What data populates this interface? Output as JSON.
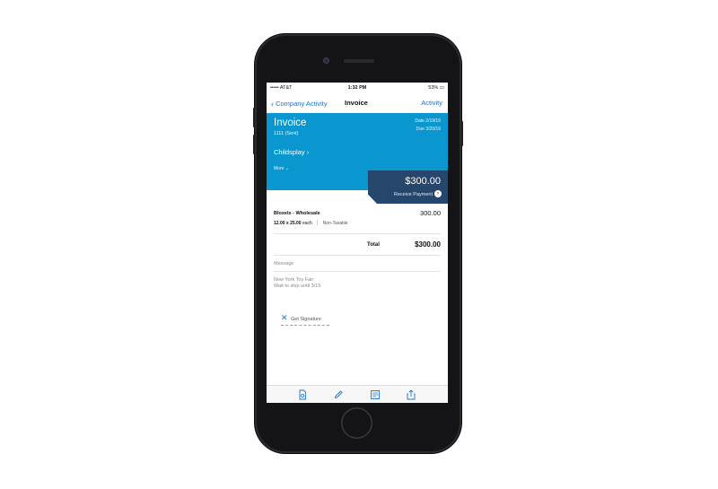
{
  "status_bar": {
    "carrier": "••••• AT&T ",
    "time": "1:32 PM",
    "battery": "53% ▭"
  },
  "nav": {
    "back_label": "Company Activity",
    "title": "Invoice",
    "right_label": "Activity"
  },
  "invoice": {
    "title": "Invoice",
    "number_status": "1111 (Sent)",
    "date": "Date 2/19/16",
    "due": "Due 3/20/16",
    "customer": "Childsplay",
    "more_label": "More"
  },
  "payment": {
    "amount": "$300.00",
    "button_label": "Receive Payment"
  },
  "line_items": [
    {
      "name": "Bloxels - Wholesale",
      "qty_rate": "12.00 x 25.00",
      "unit": "each",
      "tax": "Non-Taxable",
      "amount": "300.00"
    }
  ],
  "total": {
    "label": "Total",
    "value": "$300.00"
  },
  "message": {
    "label": "Message",
    "line1": "New York Toy Fair",
    "line2": "Wait to ship until 3/15"
  },
  "signature": {
    "label": "Get Signature"
  },
  "toolbar": {
    "icons": [
      "pdf-icon",
      "pencil-icon",
      "document-icon",
      "share-icon"
    ]
  },
  "colors": {
    "header_blue": "#0a97d0",
    "payment_navy": "#26466b",
    "link_blue": "#1c74c9"
  }
}
